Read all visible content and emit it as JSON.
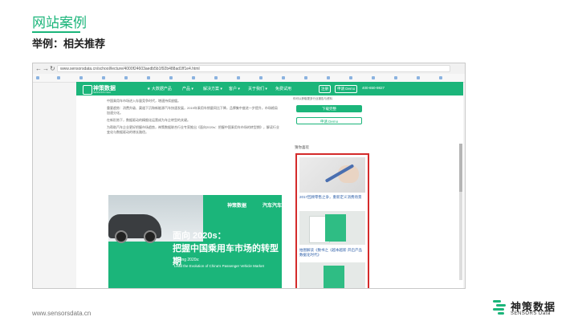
{
  "slide": {
    "title": "网站案例",
    "subtitle": "举例：相关推荐",
    "footer_url": "www.sensorsdata.cn",
    "logo_cn": "神策数据",
    "logo_en": "SENSORS Data"
  },
  "browser": {
    "back": "←",
    "forward": "→",
    "reload": "↻",
    "url": "www.sensorsdata.cn/school/lecture/4000f24603aedb5b1f92b488ad1ff1e4.html"
  },
  "site": {
    "logo": "神策数据",
    "logo_en": "SENSORS Data",
    "nav": [
      "★ 大数据产品",
      "产品 ▾",
      "解决方案 ▾",
      "客户 ▾",
      "关于我们 ▾",
      "免费试用"
    ],
    "register": "注册",
    "demo": "申请 Demo",
    "phone": "400-650-9827"
  },
  "article": {
    "paragraphs": [
      "中国乘用车市场进入存量竞争时代，增速持续放缓。",
      "重要趋势：消费升级、渠道下沉和新能源汽车快速发展，2019年乘用车销量同比下降，品牌集中度进一步提升，市场格局加速分化。",
      "在新形势下，数据驱动的精细化运营成为车企转型的关键。",
      "为帮助汽车企业更好把握市场趋势，神策数据联合行业专家推出《面向2020s：把握中国乘用车市场的转型期》，解读行业变化与数据驱动的增长路径。"
    ]
  },
  "banner": {
    "logo": "神策数据",
    "tag": "汽车汽车",
    "headline1": "面向 2020s：",
    "headline2": "把握中国乘用车市场的转型期",
    "eng1": "Facing 2020s:",
    "eng2": "Lead the Evolution of China's Passenger Vehicle Market"
  },
  "sidebar": {
    "top_text": "你可以获取更多行业报告与资料",
    "download_btn": "下载完整",
    "demo_btn": "申请 Demo",
    "rec_heading": "猜你喜欢",
    "items": [
      "2017回顾零售之争，重新定义消费场景",
      "拍图解读《数书之《越本越新·开启产品数据化时代》"
    ]
  },
  "colors": {
    "accent": "#1bb57a",
    "highlight_border": "#d42b2b"
  }
}
